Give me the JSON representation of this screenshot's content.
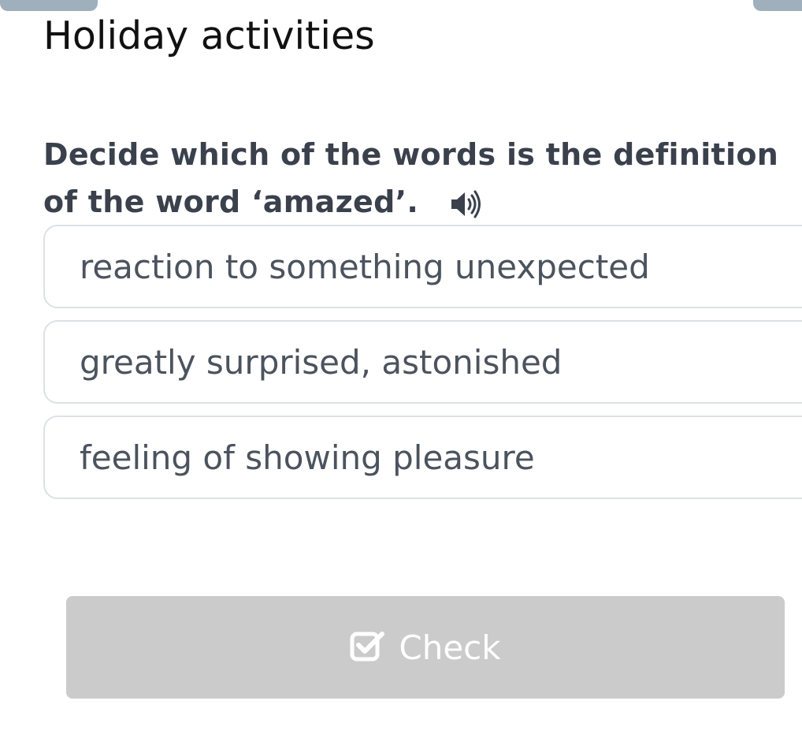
{
  "header": {
    "title": "Holiday activities"
  },
  "question": {
    "text": "Decide which of the words is the definition of the word ‘amazed’.",
    "audio_icon": "speaker-icon"
  },
  "options": [
    {
      "label": "reaction to something unexpected"
    },
    {
      "label": "greatly surprised, astonished"
    },
    {
      "label": "feeling of showing pleasure"
    }
  ],
  "check_button": {
    "label": "Check",
    "icon": "checkbox-check-icon",
    "state": "disabled"
  },
  "colors": {
    "title_text": "#111111",
    "question_text": "#3a414c",
    "option_text": "#4b535e",
    "option_border": "#dde1e5",
    "button_bg": "#cbcbcb",
    "button_text": "#ffffff",
    "tab": "#9fb0bc"
  }
}
